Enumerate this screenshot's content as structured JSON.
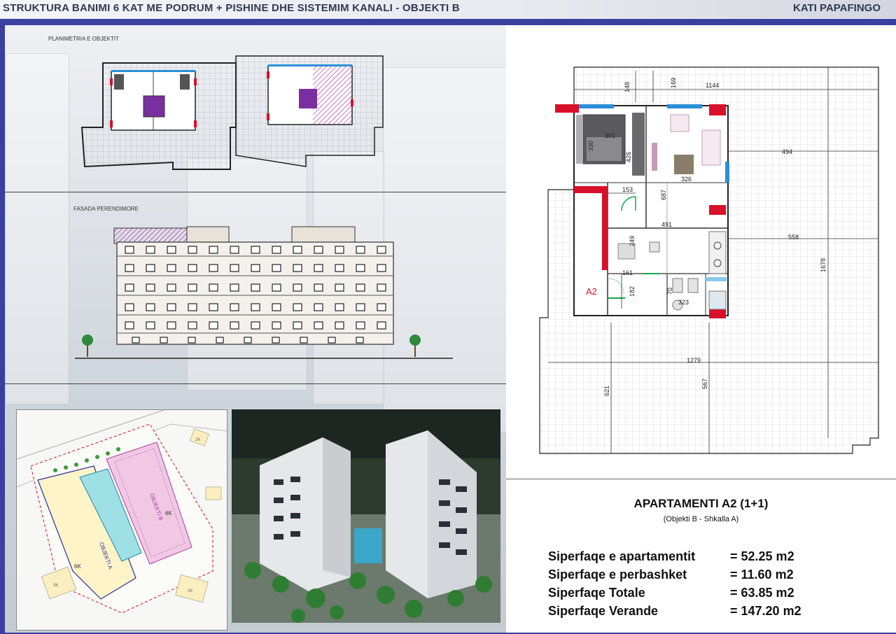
{
  "header": {
    "title": "STRUKTURA BANIMI 6 KAT ME PODRUM + PISHINE DHE SISTEMIM KANALI   - OBJEKTI B",
    "floor": "KATI PAPAFINGO"
  },
  "left_panel": {
    "plan_label": "PLANIMETRIA E OBJEKTIT",
    "facade_label": "FASADA PERENDIMORE"
  },
  "site_plan": {
    "building_label_left": "OBJEKTI A",
    "building_label_right": "OBJEKTI B",
    "height_left": "6K",
    "height_right": "6K",
    "neighbor_a": "2K",
    "neighbor_b": "3K",
    "neighbor_c": "2K"
  },
  "floor_plan": {
    "unit_label": "A2",
    "dimensions": {
      "d148": "148",
      "d169": "169",
      "d1144": "1144",
      "d301": "301",
      "d330": "330",
      "d426": "426",
      "d326": "326",
      "d494": "494",
      "d153": "153",
      "d687": "687",
      "d491": "491",
      "d249": "249",
      "d558": "558",
      "d1678": "1678",
      "d161": "161",
      "d182": "182",
      "d70": "70",
      "d323": "323",
      "d1279": "1279",
      "d621": "621",
      "d567": "567"
    }
  },
  "apartment": {
    "title": "APARTAMENTI A2 (1+1)",
    "subtitle": "(Objekti B - Shkalla A)",
    "areas": [
      {
        "label": "Siperfaqe e apartamentit",
        "value": "= 52.25 m2"
      },
      {
        "label": "Siperfaqe e perbashket",
        "value": "= 11.60 m2"
      },
      {
        "label": "Siperfaqe Totale",
        "value": "= 63.85 m2"
      },
      {
        "label": "Siperfaqe Verande",
        "value": "= 147.20 m2"
      }
    ]
  },
  "colors": {
    "frame_blue": "#3a3fa0",
    "wall_red": "#d8102a",
    "window_blue": "#2a8fd8",
    "door_green": "#12a64a",
    "roof_magenta": "#b03aa8",
    "title_navy": "#2f3a54"
  }
}
